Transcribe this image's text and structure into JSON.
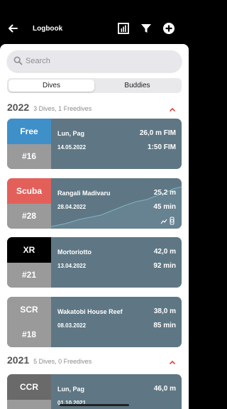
{
  "app": {
    "title": "Logbook"
  },
  "toolbar": {
    "back_icon": "arrow-left-icon",
    "stats_icon": "bar-chart-icon",
    "filter_icon": "filter-icon",
    "add_icon": "add-circle-icon"
  },
  "search": {
    "placeholder": "Search",
    "value": ""
  },
  "tabs": [
    {
      "label": "Dives",
      "selected": true
    },
    {
      "label": "Buddies",
      "selected": false
    }
  ],
  "sections": [
    {
      "year": "2022",
      "summary": "3 Dives, 1 Freedives",
      "expanded": true
    },
    {
      "year": "2021",
      "summary": "5 Dives, 0 Freedives",
      "expanded": true
    }
  ],
  "dives": [
    {
      "type": "Free",
      "color": "#3f8fc9",
      "number": "#16",
      "location": "Lun, Pag",
      "date": "14.05.2022",
      "depth": "26,0 m FIM",
      "duration": "1:50 FIM"
    },
    {
      "type": "Scuba",
      "color": "#e3605a",
      "number": "#28",
      "location": "Rangali Madivaru",
      "date": "28.04.2022",
      "depth": "25,2 m",
      "duration": "45 min",
      "device_icon": "dive-computer-watch-icon"
    },
    {
      "type": "XR",
      "color": "#000000",
      "number": "#21",
      "location": "Mortoriotto",
      "date": "13.04.2022",
      "depth": "42,0 m",
      "duration": "92 min"
    },
    {
      "type": "SCR",
      "color": "#9a9a9a",
      "number": "#18",
      "location": "Wakatobi House Reef",
      "date": "08.03.2022",
      "depth": "38,0 m",
      "duration": "85 min"
    },
    {
      "type": "CCR",
      "color": "#6a6a6a",
      "number": "",
      "location": "Lun, Pag",
      "date": "01.10.2021",
      "depth": "46,0 m",
      "duration": ""
    }
  ],
  "colors": {
    "card_bg": "#5f7784",
    "number_bg": "#9a9a9a",
    "accent": "#e0433a"
  }
}
